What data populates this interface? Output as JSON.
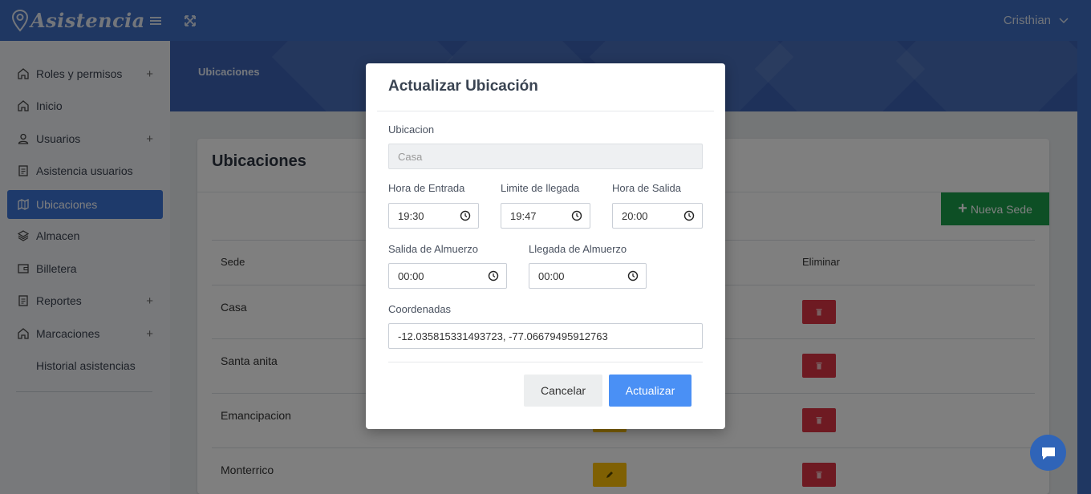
{
  "app": {
    "brand": "Asistencia",
    "user": "Cristhian"
  },
  "sidebar": {
    "items": [
      {
        "label": "Roles y permisos",
        "icon": "home-icon",
        "expandable": true
      },
      {
        "label": "Inicio",
        "icon": "home-icon",
        "expandable": false
      },
      {
        "label": "Usuarios",
        "icon": "user-icon",
        "expandable": true
      },
      {
        "label": "Asistencia usuarios",
        "icon": "document-icon",
        "expandable": false
      },
      {
        "label": "Ubicaciones",
        "icon": "map-icon",
        "expandable": false,
        "active": true
      },
      {
        "label": "Almacen",
        "icon": "layers-icon",
        "expandable": false
      },
      {
        "label": "Billetera",
        "icon": "wallet-icon",
        "expandable": false
      },
      {
        "label": "Reportes",
        "icon": "document-icon",
        "expandable": true
      },
      {
        "label": "Marcaciones",
        "icon": "home-icon",
        "expandable": true
      },
      {
        "label": "Historial asistencias",
        "icon": "",
        "expandable": false
      }
    ],
    "plus_symbol": "+"
  },
  "header": {
    "breadcrumb": "Ubicaciones"
  },
  "card": {
    "title": "Ubicaciones",
    "new_button": "Nueva Sede",
    "new_button_plus": "+",
    "columns": {
      "sede": "Sede",
      "eliminar": "Eliminar"
    },
    "rows": [
      {
        "sede": "Casa"
      },
      {
        "sede": "Santa anita"
      },
      {
        "sede": "Emancipacion"
      },
      {
        "sede": "Monterrico"
      }
    ]
  },
  "modal": {
    "title": "Actualizar Ubicación",
    "ubicacion_label": "Ubicacion",
    "ubicacion_value": "Casa",
    "hora_entrada_label": "Hora de Entrada",
    "hora_entrada_value": "19:30",
    "limite_llegada_label": "Limite de llegada",
    "limite_llegada_value": "19:47",
    "hora_salida_label": "Hora de Salida",
    "hora_salida_value": "20:00",
    "salida_almuerzo_label": "Salida de Almuerzo",
    "salida_almuerzo_value": "00:00",
    "llegada_almuerzo_label": "Llegada de Almuerzo",
    "llegada_almuerzo_value": "00:00",
    "coordenadas_label": "Coordenadas",
    "coordenadas_value": "-12.035815331493723, -77.06679495912763",
    "cancel_label": "Cancelar",
    "update_label": "Actualizar"
  },
  "colors": {
    "primary": "#3f6fc4",
    "active": "#3d74d6",
    "success": "#1a9e4b",
    "danger": "#dc3545",
    "warning": "#ffc107",
    "update_button": "#4a90f5"
  }
}
